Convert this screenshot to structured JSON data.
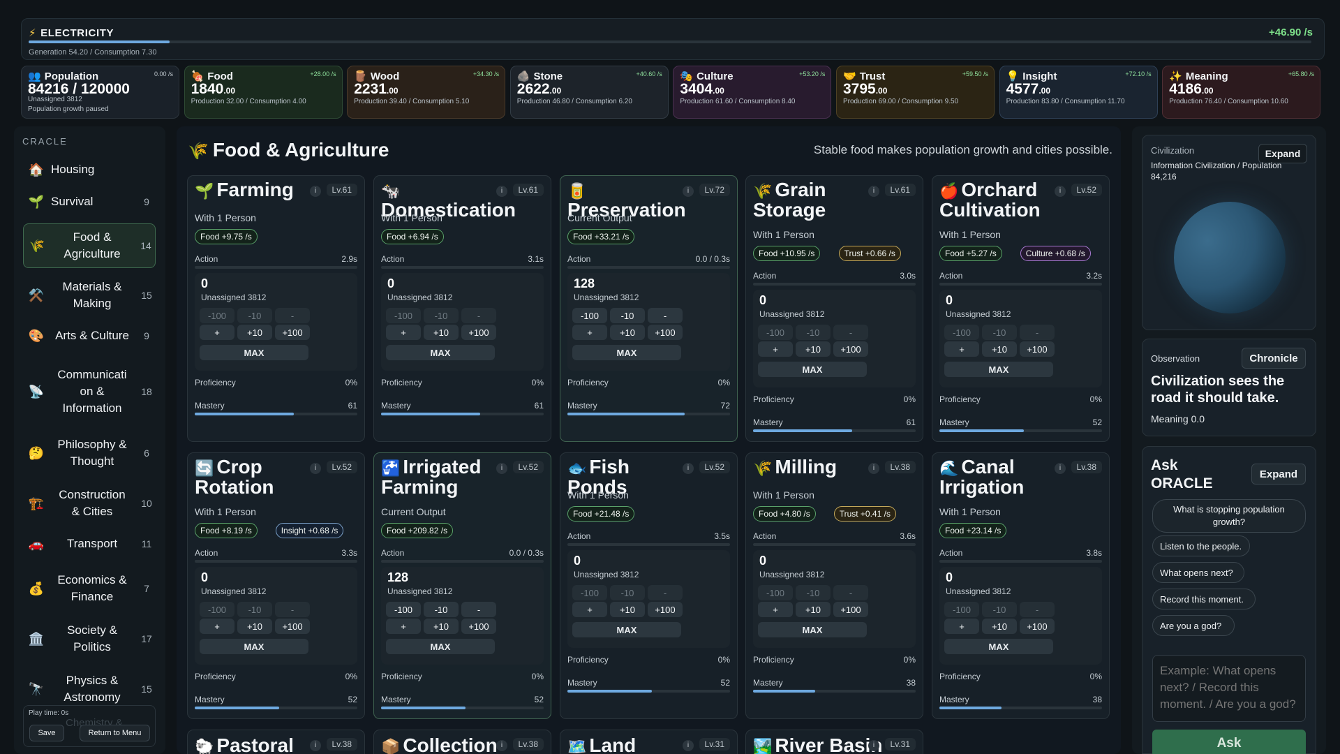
{
  "electricity": {
    "icon": "⚡",
    "title": "ELECTRICITY",
    "rate": "+46.90 /s",
    "sub": "Generation 54.20 / Consumption 7.30",
    "progress": 0.11
  },
  "resources": [
    {
      "icon": "👥",
      "name": "Population",
      "rate": "0.00 /s",
      "value": "84216 / 120000",
      "cents": "",
      "l1": "Unassigned 3812",
      "l2": "Population growth paused",
      "bg": "#1a2129",
      "border": "#2c353d"
    },
    {
      "icon": "🍖",
      "name": "Food",
      "rate": "+28.00 /s",
      "value": "1840",
      "cents": ".00",
      "l1": "Production 32.00 / Consumption 4.00",
      "l2": "",
      "bg": "#1a2a1e",
      "border": "#2e4a34"
    },
    {
      "icon": "🪵",
      "name": "Wood",
      "rate": "+34.30 /s",
      "value": "2231",
      "cents": ".00",
      "l1": "Production 39.40 / Consumption 5.10",
      "l2": "",
      "bg": "#2a2119",
      "border": "#4a3a2a"
    },
    {
      "icon": "🪨",
      "name": "Stone",
      "rate": "+40.60 /s",
      "value": "2622",
      "cents": ".00",
      "l1": "Production 46.80 / Consumption 6.20",
      "l2": "",
      "bg": "#1d232a",
      "border": "#323c45"
    },
    {
      "icon": "🎭",
      "name": "Culture",
      "rate": "+53.20 /s",
      "value": "3404",
      "cents": ".00",
      "l1": "Production 61.60 / Consumption 8.40",
      "l2": "",
      "bg": "#281b2e",
      "border": "#4a3050"
    },
    {
      "icon": "🤝",
      "name": "Trust",
      "rate": "+59.50 /s",
      "value": "3795",
      "cents": ".00",
      "l1": "Production 69.00 / Consumption 9.50",
      "l2": "",
      "bg": "#2b2414",
      "border": "#4e4124"
    },
    {
      "icon": "💡",
      "name": "Insight",
      "rate": "+72.10 /s",
      "value": "4577",
      "cents": ".00",
      "l1": "Production 83.80 / Consumption 11.70",
      "l2": "",
      "bg": "#1a2430",
      "border": "#2e4056"
    },
    {
      "icon": "✨",
      "name": "Meaning",
      "rate": "+65.80 /s",
      "value": "4186",
      "cents": ".00",
      "l1": "Production 76.40 / Consumption 10.60",
      "l2": "",
      "bg": "#2c1a1e",
      "border": "#4e2e34"
    }
  ],
  "sidebar": {
    "header": "CRACLE",
    "items": [
      {
        "icon": "🏠",
        "label": "Housing",
        "count": ""
      },
      {
        "icon": "🌱",
        "label": "Survival",
        "count": "9"
      },
      {
        "icon": "🌾",
        "label": "Food &\nAgriculture",
        "count": "14"
      },
      {
        "icon": "⚒️",
        "label": "Materials &\nMaking",
        "count": "15"
      },
      {
        "icon": "🎨",
        "label": "Arts & Culture",
        "count": "9"
      },
      {
        "icon": "📡",
        "label": "Communicati\non &\nInformation",
        "count": "18"
      },
      {
        "icon": "🤔",
        "label": "Philosophy &\nThought",
        "count": "6"
      },
      {
        "icon": "🏗️",
        "label": "Construction\n& Cities",
        "count": "10"
      },
      {
        "icon": "🚗",
        "label": "Transport",
        "count": "11"
      },
      {
        "icon": "💰",
        "label": "Economics &\nFinance",
        "count": "7"
      },
      {
        "icon": "🏛️",
        "label": "Society &\nPolitics",
        "count": "17"
      },
      {
        "icon": "🔭",
        "label": "Physics &\nAstronomy",
        "count": "15"
      }
    ],
    "play_time": "Play time: 0s",
    "ghost": "Chemistry &",
    "save": "Save",
    "return": "Return to Menu"
  },
  "section": {
    "icon": "🌾",
    "title": "Food & Agriculture",
    "desc": "Stable food makes population growth and cities possible."
  },
  "labels": {
    "action": "Action",
    "proficiency": "Proficiency",
    "mastery": "Mastery",
    "unassigned": "Unassigned 3812",
    "info": "i"
  },
  "buttons": {
    "m100": "-100",
    "m10": "-10",
    "m1": "-",
    "p1": "+",
    "p10": "+10",
    "p100": "+100",
    "max": "MAX"
  },
  "cards": [
    {
      "icon": "🌱",
      "title": "Farming",
      "level": "Lv.61",
      "sub": "With 1 Person",
      "pills": [
        {
          "t": "Food +9.75 /s",
          "c": ""
        }
      ],
      "time": "2.9s",
      "count": "0",
      "prof": "0%",
      "mastery": "61",
      "mfrac": 0.61,
      "active": false
    },
    {
      "icon": "🐄",
      "title": "Domestication",
      "level": "Lv.61",
      "sub": "With 1 Person",
      "pills": [
        {
          "t": "Food +6.94 /s",
          "c": ""
        }
      ],
      "time": "3.1s",
      "count": "0",
      "prof": "0%",
      "mastery": "61",
      "mfrac": 0.61,
      "active": false
    },
    {
      "icon": "🥫",
      "title": "Preservation",
      "level": "Lv.72",
      "sub": "Current Output",
      "pills": [
        {
          "t": "Food +33.21 /s",
          "c": ""
        }
      ],
      "time": "0.0 / 0.3s",
      "count": "128",
      "prof": "0%",
      "mastery": "72",
      "mfrac": 0.72,
      "active": true
    },
    {
      "icon": "🌾",
      "title": "Grain Storage",
      "level": "Lv.61",
      "sub": "With 1 Person",
      "pills": [
        {
          "t": "Food +10.95 /s",
          "c": ""
        },
        {
          "t": "Trust +0.66 /s",
          "c": "p2"
        }
      ],
      "time": "3.0s",
      "count": "0",
      "prof": "0%",
      "mastery": "61",
      "mfrac": 0.61,
      "active": false
    },
    {
      "icon": "🍎",
      "title": "Orchard Cultivation",
      "level": "Lv.52",
      "sub": "With 1 Person",
      "pills": [
        {
          "t": "Food +5.27 /s",
          "c": ""
        },
        {
          "t": "Culture +0.68 /s",
          "c": "p3"
        }
      ],
      "time": "3.2s",
      "count": "0",
      "prof": "0%",
      "mastery": "52",
      "mfrac": 0.52,
      "active": false
    },
    {
      "icon": "🔄",
      "title": "Crop Rotation",
      "level": "Lv.52",
      "sub": "With 1 Person",
      "pills": [
        {
          "t": "Food +8.19 /s",
          "c": ""
        },
        {
          "t": "Insight +0.68 /s",
          "c": "p4"
        }
      ],
      "time": "3.3s",
      "count": "0",
      "prof": "0%",
      "mastery": "52",
      "mfrac": 0.52,
      "active": false
    },
    {
      "icon": "🚰",
      "title": "Irrigated Farming",
      "level": "Lv.52",
      "sub": "Current Output",
      "pills": [
        {
          "t": "Food +209.82 /s",
          "c": ""
        }
      ],
      "time": "0.0 / 0.3s",
      "count": "128",
      "prof": "0%",
      "mastery": "52",
      "mfrac": 0.52,
      "active": true
    },
    {
      "icon": "🐟",
      "title": "Fish Ponds",
      "level": "Lv.52",
      "sub": "With 1 Person",
      "pills": [
        {
          "t": "Food +21.48 /s",
          "c": ""
        }
      ],
      "time": "3.5s",
      "count": "0",
      "prof": "0%",
      "mastery": "52",
      "mfrac": 0.52,
      "active": false
    },
    {
      "icon": "🌾",
      "title": "Milling",
      "level": "Lv.38",
      "sub": "With 1 Person",
      "pills": [
        {
          "t": "Food +4.80 /s",
          "c": ""
        },
        {
          "t": "Trust +0.41 /s",
          "c": "p2"
        }
      ],
      "time": "3.6s",
      "count": "0",
      "prof": "0%",
      "mastery": "38",
      "mfrac": 0.38,
      "active": false
    },
    {
      "icon": "🌊",
      "title": "Canal Irrigation",
      "level": "Lv.38",
      "sub": "With 1 Person",
      "pills": [
        {
          "t": "Food +23.14 /s",
          "c": ""
        }
      ],
      "time": "3.8s",
      "count": "0",
      "prof": "0%",
      "mastery": "38",
      "mfrac": 0.38,
      "active": false
    }
  ],
  "stubs": [
    {
      "icon": "🐑",
      "title": "Pastoral",
      "level": "Lv.38"
    },
    {
      "icon": "📦",
      "title": "Collection",
      "level": "Lv.38"
    },
    {
      "icon": "🗺️",
      "title": "Land",
      "level": "Lv.31"
    },
    {
      "icon": "🏞️",
      "title": "River Basin",
      "level": "Lv.31"
    }
  ],
  "right": {
    "civ_label": "Civilization",
    "civ_expand": "Expand",
    "civ_sub": "Information Civilization / Population",
    "civ_pop": "84,216",
    "obs_label": "Observation",
    "obs_btn": "Chronicle",
    "obs_text": "Civilization sees the road it should take.",
    "obs_meaning": "Meaning 0.0",
    "ask_title": "Ask\nORACLE",
    "ask_expand": "Expand",
    "chips": [
      "What is stopping population growth?",
      "Listen to the people.",
      "What opens next?",
      "Record this moment.",
      "Are you a god?"
    ],
    "placeholder": "Example: What opens next? / Record this moment. / Are you a god?",
    "ask_btn": "Ask"
  }
}
